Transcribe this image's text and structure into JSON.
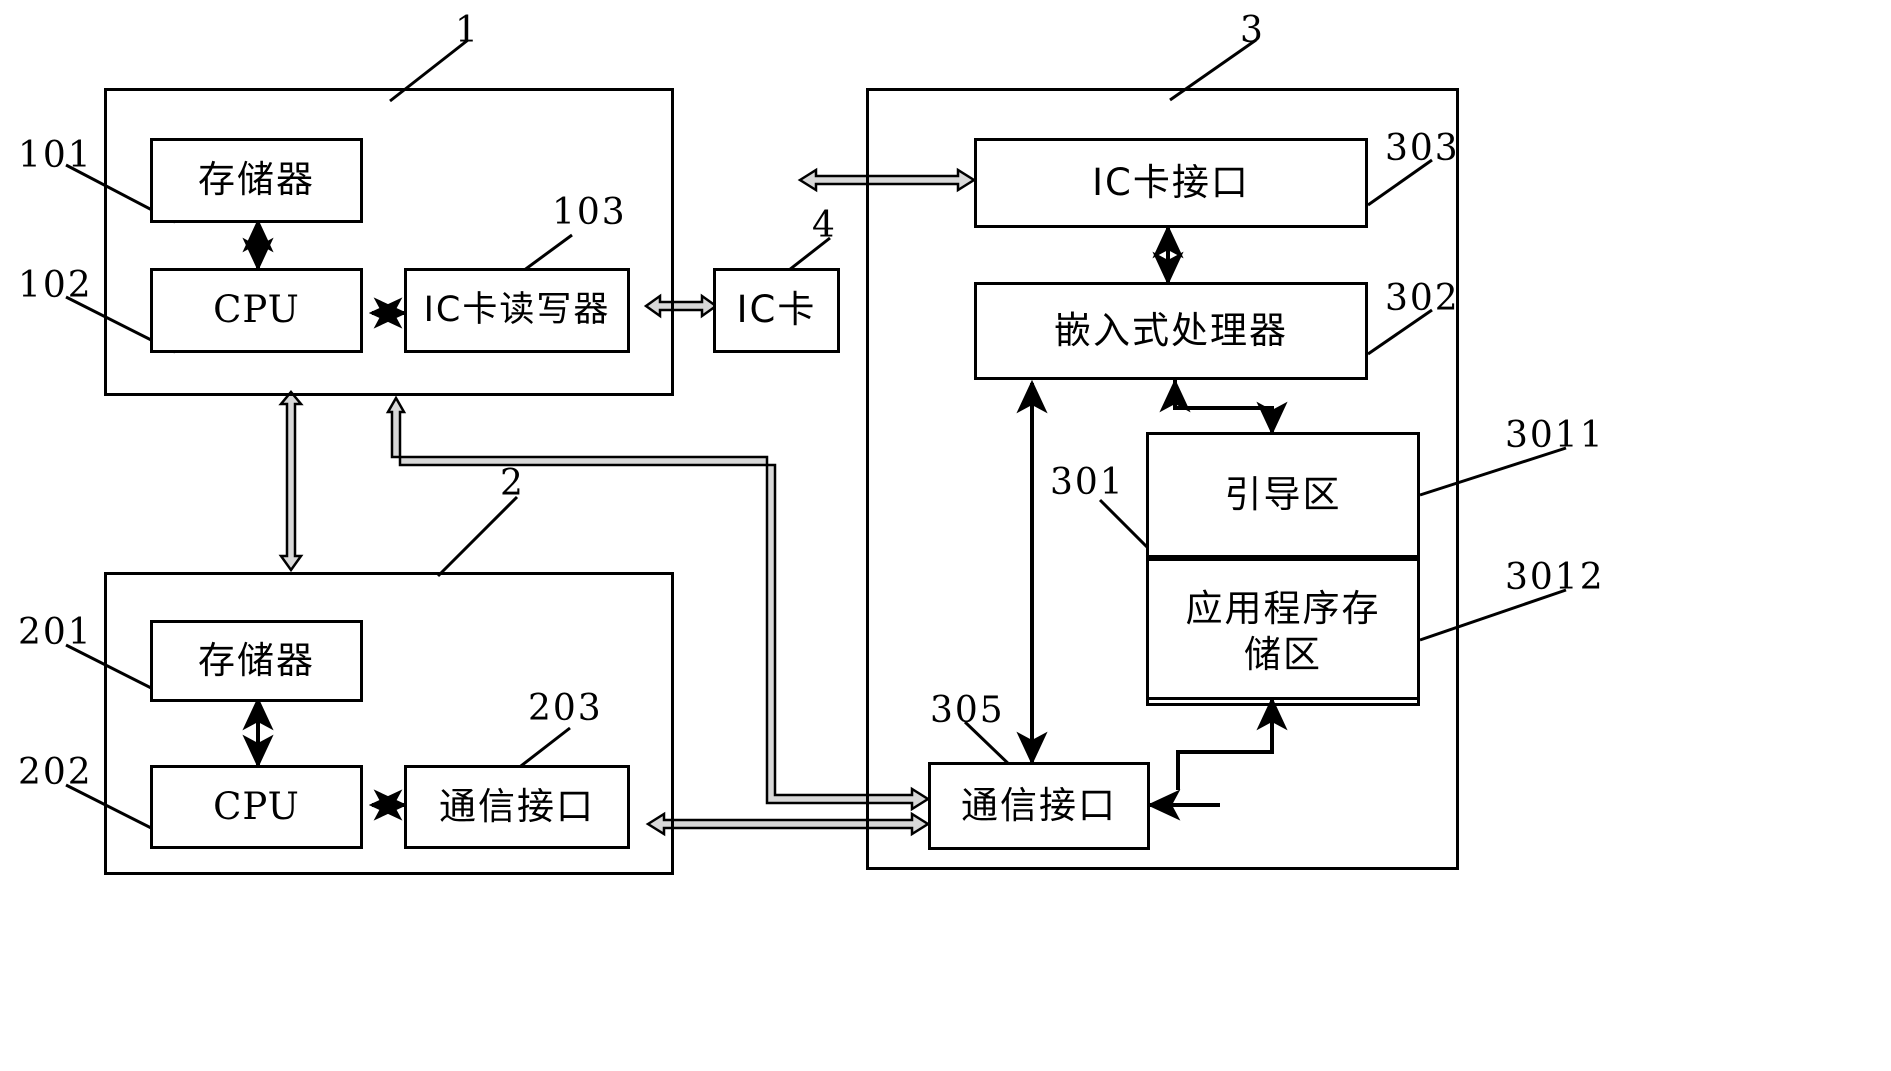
{
  "diagram": {
    "title": "IC card terminal / embedded controller block diagram",
    "background": "#ffffff",
    "line_color": "#000000",
    "blocks": {
      "terminal_outer": {
        "ref": "1",
        "label": ""
      },
      "terminal_memory": {
        "ref": "101",
        "label": "存储器"
      },
      "terminal_cpu": {
        "ref": "102",
        "label": "CPU"
      },
      "terminal_card_rw": {
        "ref": "103",
        "label": "IC卡读写器"
      },
      "ic_card": {
        "ref": "4",
        "label": "IC卡"
      },
      "host_outer": {
        "ref": "2",
        "label": ""
      },
      "host_memory": {
        "ref": "201",
        "label": "存储器"
      },
      "host_cpu": {
        "ref": "202",
        "label": "CPU"
      },
      "host_comm": {
        "ref": "203",
        "label": "通信接口"
      },
      "device_outer": {
        "ref": "3",
        "label": ""
      },
      "device_card_if": {
        "ref": "303",
        "label": "IC卡接口"
      },
      "device_cpu": {
        "ref": "302",
        "label": "嵌入式处理器"
      },
      "device_storage": {
        "ref": "301",
        "label": ""
      },
      "device_boot_area": {
        "ref": "3011",
        "label": "引导区"
      },
      "device_app_area": {
        "ref": "3012",
        "label": "应用程序存储区"
      },
      "device_comm": {
        "ref": "305",
        "label": "通信接口"
      }
    },
    "ref_labels": [
      {
        "name": "ref-1",
        "text": "1"
      },
      {
        "name": "ref-101",
        "text": "101"
      },
      {
        "name": "ref-102",
        "text": "102"
      },
      {
        "name": "ref-103",
        "text": "103"
      },
      {
        "name": "ref-4",
        "text": "4"
      },
      {
        "name": "ref-2",
        "text": "2"
      },
      {
        "name": "ref-201",
        "text": "201"
      },
      {
        "name": "ref-202",
        "text": "202"
      },
      {
        "name": "ref-203",
        "text": "203"
      },
      {
        "name": "ref-3",
        "text": "3"
      },
      {
        "name": "ref-303",
        "text": "303"
      },
      {
        "name": "ref-302",
        "text": "302"
      },
      {
        "name": "ref-301",
        "text": "301"
      },
      {
        "name": "ref-3011",
        "text": "3011"
      },
      {
        "name": "ref-3012",
        "text": "3012"
      },
      {
        "name": "ref-305",
        "text": "305"
      }
    ]
  }
}
